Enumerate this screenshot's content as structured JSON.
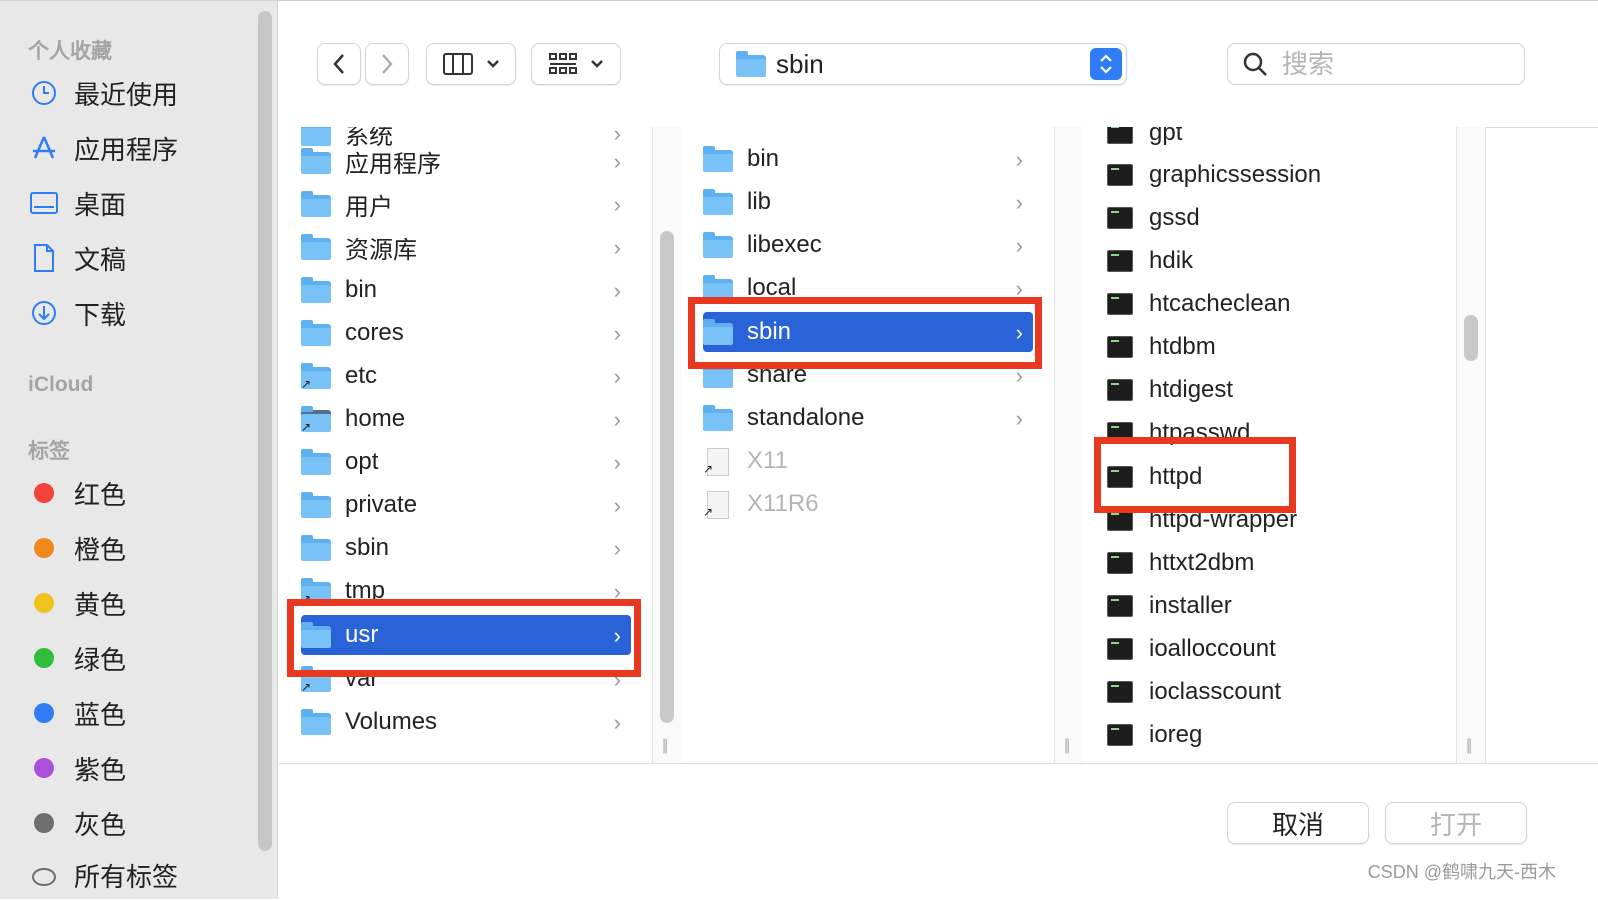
{
  "sidebar": {
    "favorites_header": "个人收藏",
    "favorites": [
      {
        "label": "最近使用",
        "icon": "clock-icon"
      },
      {
        "label": "应用程序",
        "icon": "applications-icon"
      },
      {
        "label": "桌面",
        "icon": "desktop-icon"
      },
      {
        "label": "文稿",
        "icon": "document-icon"
      },
      {
        "label": "下载",
        "icon": "download-icon"
      }
    ],
    "icloud_header": "iCloud",
    "tags_header": "标签",
    "tags": [
      {
        "label": "红色",
        "color": "#f4433a"
      },
      {
        "label": "橙色",
        "color": "#f0881d"
      },
      {
        "label": "黄色",
        "color": "#f2c21c"
      },
      {
        "label": "绿色",
        "color": "#2fbd3e"
      },
      {
        "label": "蓝色",
        "color": "#2f7cf6"
      },
      {
        "label": "紫色",
        "color": "#ac50d8"
      },
      {
        "label": "灰色",
        "color": "#6e6e6e"
      }
    ],
    "all_tags": "所有标签"
  },
  "toolbar": {
    "location": "sbin",
    "search_placeholder": "搜索"
  },
  "columns": {
    "col1": [
      {
        "name": "系统",
        "icon": "folder",
        "partial": true
      },
      {
        "name": "应用程序",
        "icon": "folder"
      },
      {
        "name": "用户",
        "icon": "folder"
      },
      {
        "name": "资源库",
        "icon": "folder"
      },
      {
        "name": "bin",
        "icon": "folder"
      },
      {
        "name": "cores",
        "icon": "folder"
      },
      {
        "name": "etc",
        "icon": "folder-alias"
      },
      {
        "name": "home",
        "icon": "network-alias"
      },
      {
        "name": "opt",
        "icon": "folder"
      },
      {
        "name": "private",
        "icon": "folder"
      },
      {
        "name": "sbin",
        "icon": "folder"
      },
      {
        "name": "tmp",
        "icon": "folder-alias"
      },
      {
        "name": "usr",
        "icon": "folder",
        "selected": true
      },
      {
        "name": "var",
        "icon": "folder-alias"
      },
      {
        "name": "Volumes",
        "icon": "folder"
      }
    ],
    "col2": [
      {
        "name": "bin",
        "icon": "folder"
      },
      {
        "name": "lib",
        "icon": "folder"
      },
      {
        "name": "libexec",
        "icon": "folder"
      },
      {
        "name": "local",
        "icon": "folder"
      },
      {
        "name": "sbin",
        "icon": "folder",
        "selected": true
      },
      {
        "name": "share",
        "icon": "folder"
      },
      {
        "name": "standalone",
        "icon": "folder"
      },
      {
        "name": "X11",
        "icon": "alias",
        "dim": true
      },
      {
        "name": "X11R6",
        "icon": "alias",
        "dim": true
      }
    ],
    "col3": [
      {
        "name": "gpt"
      },
      {
        "name": "graphicssession"
      },
      {
        "name": "gssd"
      },
      {
        "name": "hdik"
      },
      {
        "name": "htcacheclean"
      },
      {
        "name": "htdbm"
      },
      {
        "name": "htdigest"
      },
      {
        "name": "htpasswd"
      },
      {
        "name": "httpd"
      },
      {
        "name": "httpd-wrapper"
      },
      {
        "name": "httxt2dbm"
      },
      {
        "name": "installer"
      },
      {
        "name": "ioalloccount"
      },
      {
        "name": "ioclasscount"
      },
      {
        "name": "ioreg"
      }
    ]
  },
  "footer": {
    "cancel_label": "取消",
    "open_label": "打开"
  },
  "watermark": "CSDN @鹤啸九天-西木"
}
